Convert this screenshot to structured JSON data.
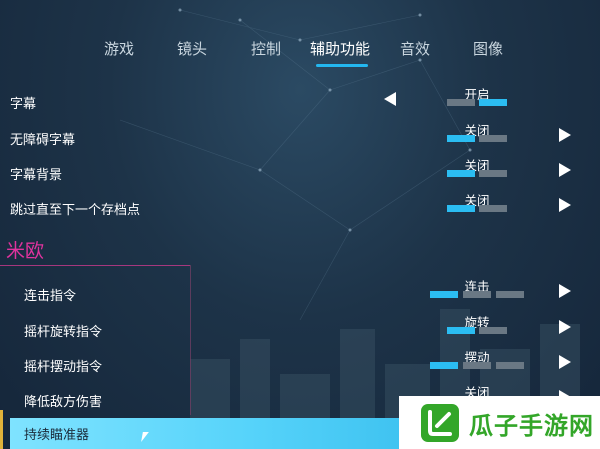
{
  "tabs": [
    {
      "label": "游戏",
      "active": false
    },
    {
      "label": "镜头",
      "active": false
    },
    {
      "label": "控制",
      "active": false
    },
    {
      "label": "辅助功能",
      "active": true
    },
    {
      "label": "音效",
      "active": false
    },
    {
      "label": "图像",
      "active": false
    }
  ],
  "rows_general": [
    {
      "label": "字幕",
      "value": "开启",
      "segments": [
        false,
        true
      ],
      "arrow": "left"
    },
    {
      "label": "无障碍字幕",
      "value": "关闭",
      "segments": [
        true,
        false
      ],
      "arrow": "right"
    },
    {
      "label": "字幕背景",
      "value": "关闭",
      "segments": [
        true,
        false
      ],
      "arrow": "right"
    },
    {
      "label": "跳过直至下一个存档点",
      "value": "关闭",
      "segments": [
        true,
        false
      ],
      "arrow": "right"
    }
  ],
  "section": {
    "title": "米欧"
  },
  "rows_section": [
    {
      "label": "连击指令",
      "value": "连击",
      "segments": [
        true,
        false,
        false
      ],
      "arrow": "right"
    },
    {
      "label": "摇杆旋转指令",
      "value": "旋转",
      "segments": [
        true,
        false
      ],
      "arrow": "right"
    },
    {
      "label": "摇杆摆动指令",
      "value": "摆动",
      "segments": [
        true,
        false,
        false
      ],
      "arrow": "right"
    },
    {
      "label": "降低敌方伤害",
      "value": "关闭",
      "segments": [],
      "arrow": "right"
    }
  ],
  "highlighted_row": {
    "label": "持续瞄准器"
  },
  "watermark": {
    "text": "瓜子手游网"
  },
  "colors": {
    "accent": "#2bbdf2",
    "section": "#e0339e",
    "inactive_segment": "#6a7884",
    "watermark": "#33a629"
  }
}
